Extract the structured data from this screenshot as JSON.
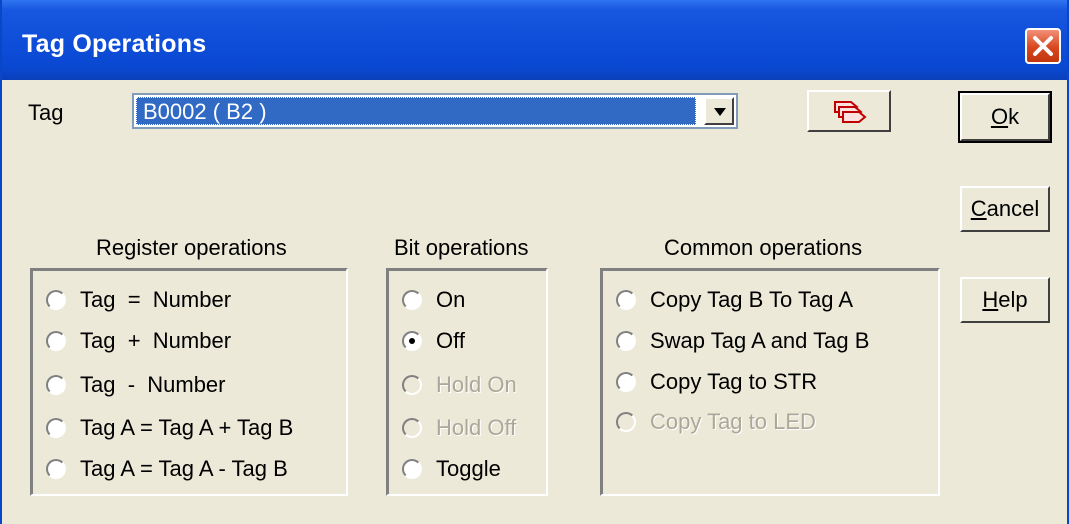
{
  "window": {
    "title": "Tag Operations"
  },
  "tag": {
    "label": "Tag",
    "value": "B0002 ( B2 )"
  },
  "buttons": {
    "ok": "Ok",
    "cancel": "Cancel",
    "help": "Help"
  },
  "register": {
    "heading": "Register operations",
    "options": [
      {
        "label": "Tag  =  Number",
        "selected": false,
        "enabled": true
      },
      {
        "label": "Tag  +  Number",
        "selected": false,
        "enabled": true
      },
      {
        "label": "Tag  -  Number",
        "selected": false,
        "enabled": true
      },
      {
        "label": "Tag A = Tag A + Tag B",
        "selected": false,
        "enabled": true
      },
      {
        "label": "Tag A = Tag A - Tag B",
        "selected": false,
        "enabled": true
      }
    ]
  },
  "bit": {
    "heading": "Bit operations",
    "options": [
      {
        "label": "On",
        "selected": false,
        "enabled": true
      },
      {
        "label": "Off",
        "selected": true,
        "enabled": true
      },
      {
        "label": "Hold On",
        "selected": false,
        "enabled": false
      },
      {
        "label": "Hold Off",
        "selected": false,
        "enabled": false
      },
      {
        "label": "Toggle",
        "selected": false,
        "enabled": true
      }
    ]
  },
  "common": {
    "heading": "Common operations",
    "options": [
      {
        "label": "Copy Tag B To Tag A",
        "selected": false,
        "enabled": true
      },
      {
        "label": "Swap Tag A and Tag B",
        "selected": false,
        "enabled": true
      },
      {
        "label": "Copy Tag to STR",
        "selected": false,
        "enabled": true
      },
      {
        "label": "Copy Tag to LED",
        "selected": false,
        "enabled": false
      }
    ]
  },
  "colors": {
    "titlebar": "#0a48d2",
    "face": "#ece9d8",
    "selection": "#316ac5",
    "close": "#d8471d"
  }
}
